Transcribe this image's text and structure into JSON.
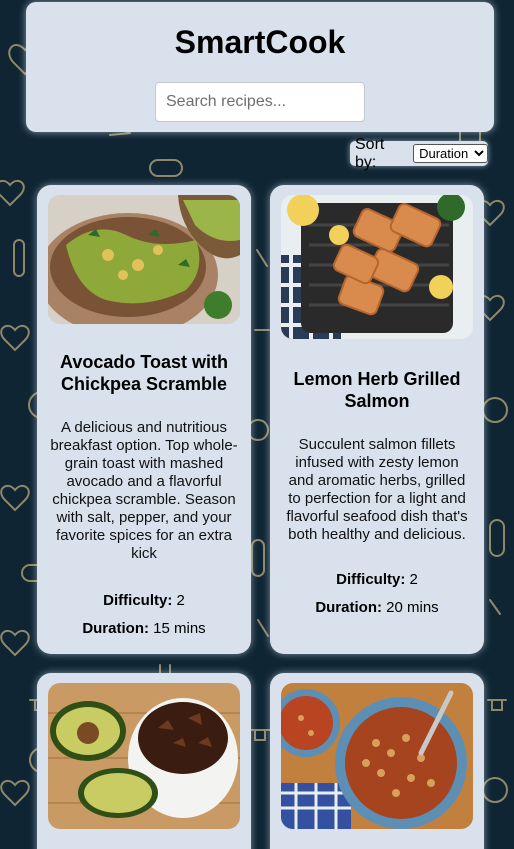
{
  "app": {
    "title": "SmartCook"
  },
  "search": {
    "placeholder": "Search recipes..."
  },
  "sort": {
    "label": "Sort by:",
    "selected": "Duration"
  },
  "labels": {
    "difficulty": "Difficulty:",
    "duration": "Duration:"
  },
  "recipes": [
    {
      "title": "Avocado Toast with Chickpea Scramble",
      "description": "A delicious and nutritious breakfast option. Top whole-grain toast with mashed avocado and a flavorful chickpea scramble. Season with salt, pepper, and your favorite spices for an extra kick",
      "difficulty": "2",
      "duration": "15 mins"
    },
    {
      "title": "Lemon Herb Grilled Salmon",
      "description": "Succulent salmon fillets infused with zesty lemon and aromatic herbs, grilled to perfection for a light and flavorful seafood dish that's both healthy and delicious.",
      "difficulty": "2",
      "duration": "20 mins"
    },
    {
      "title": "",
      "description": "",
      "difficulty": "",
      "duration": ""
    },
    {
      "title": "",
      "description": "",
      "difficulty": "",
      "duration": ""
    }
  ],
  "colors": {
    "background": "#0f2533",
    "panel": "#d9e2ec",
    "doodle": "#c9b98a"
  }
}
